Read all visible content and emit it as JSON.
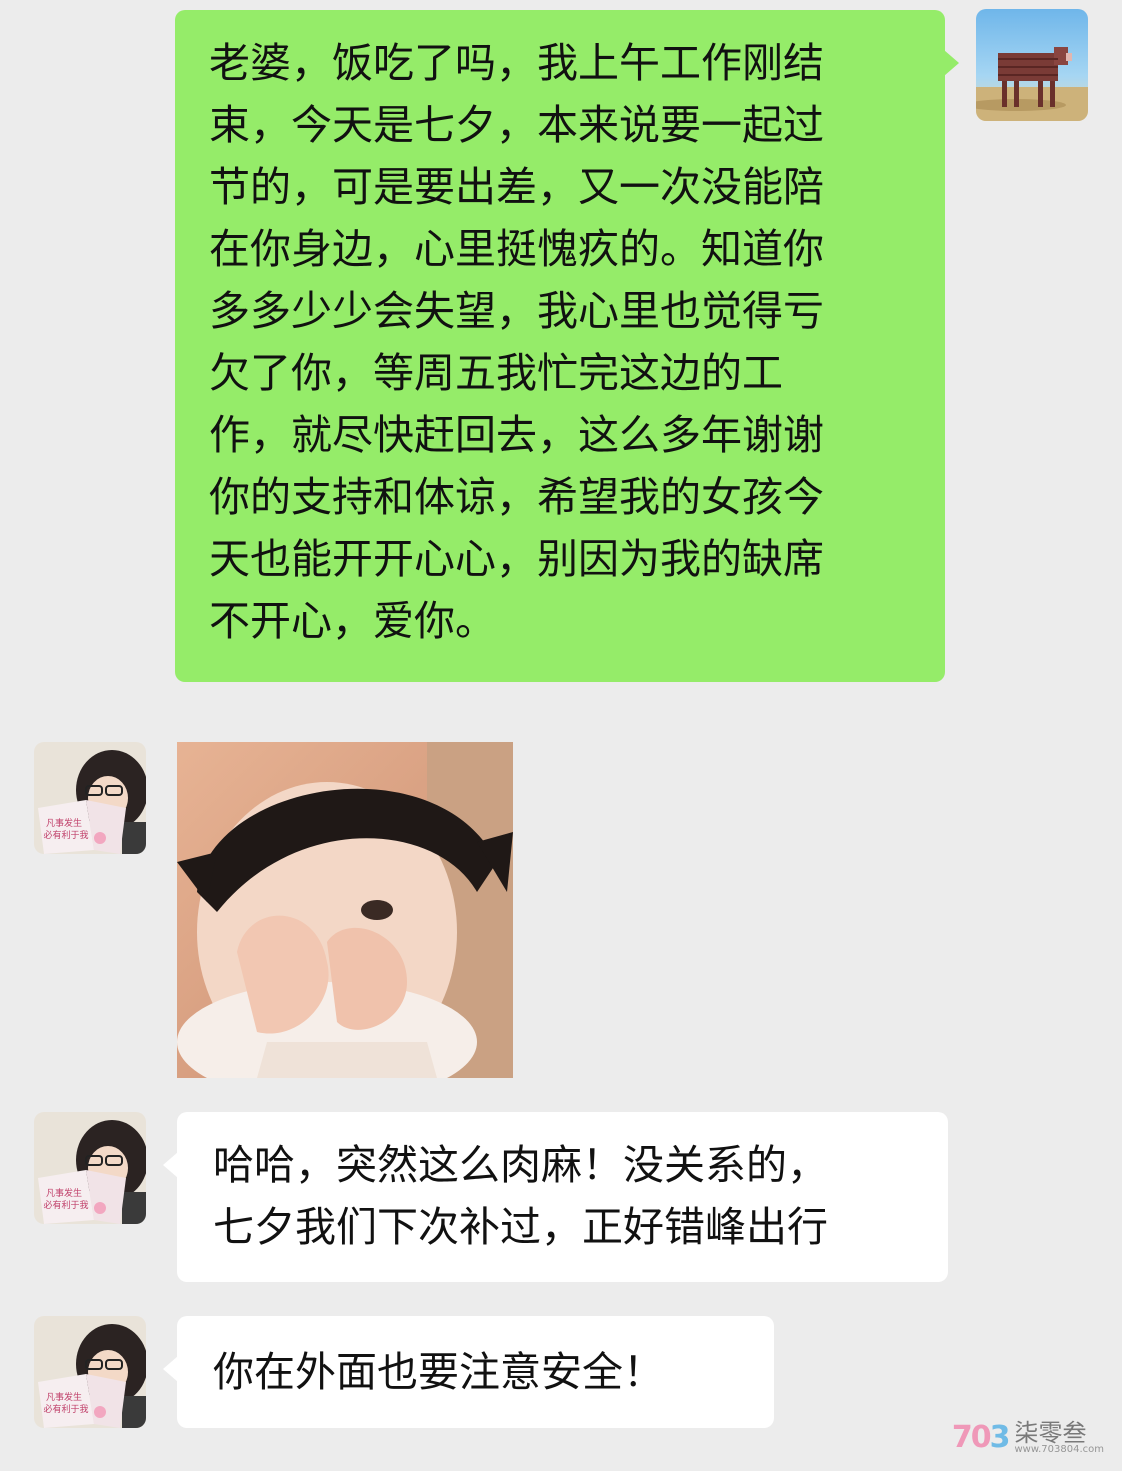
{
  "colors": {
    "background": "#ececec",
    "sent_bubble": "#95ec69",
    "received_bubble": "#ffffff"
  },
  "messages": [
    {
      "direction": "sent",
      "lines": [
        "老婆，饭吃了吗，我上午工作刚结",
        "束，今天是七夕，本来说要一起过",
        "节的，可是要出差，又一次没能陪",
        "在你身边，心里挺愧疚的。知道你",
        "多多少少会失望，我心里也觉得亏",
        "欠了你，等周五我忙完这边的工",
        "作，就尽快赶回去，这么多年谢谢",
        "你的支持和体谅，希望我的女孩今",
        "天也能开开心心，别因为我的缺席",
        "不开心，爱你。"
      ]
    },
    {
      "direction": "received",
      "type": "sticker",
      "icon": "crying-child-sticker"
    },
    {
      "direction": "received",
      "lines": [
        "哈哈，突然这么肉麻！没关系的，",
        "七夕我们下次补过，正好错峰出行"
      ]
    },
    {
      "direction": "received",
      "lines": [
        "你在外面也要注意安全！"
      ]
    }
  ],
  "avatar_other": {
    "book_text": [
      "凡事发生",
      "必有利于我"
    ]
  },
  "watermark": {
    "logo_a": "70",
    "logo_b": "3",
    "name": "柒零叁",
    "url": "www.703804.com"
  }
}
